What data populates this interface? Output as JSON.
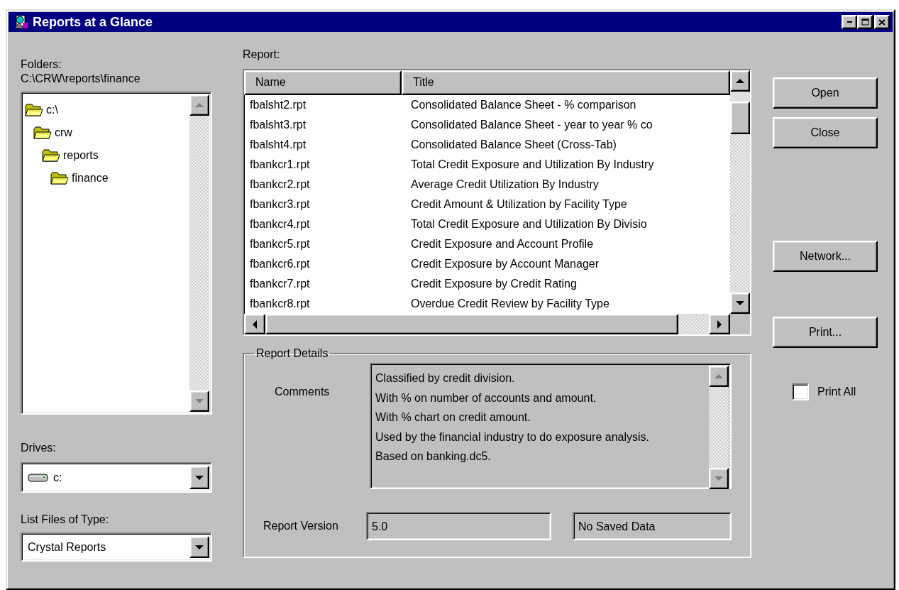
{
  "window": {
    "title": "Reports at a Glance"
  },
  "folders": {
    "label": "Folders:",
    "path": "C:\\CRW\\reports\\finance",
    "tree": [
      {
        "label": "c:\\",
        "children": [
          {
            "label": "crw",
            "children": [
              {
                "label": "reports",
                "children": [
                  {
                    "label": "finance"
                  }
                ]
              }
            ]
          }
        ]
      }
    ]
  },
  "drives": {
    "label": "Drives:",
    "value": "c:"
  },
  "file_type": {
    "label": "List Files of Type:",
    "value": "Crystal Reports"
  },
  "report": {
    "label": "Report:",
    "columns": [
      "Name",
      "Title"
    ],
    "rows": [
      {
        "name": "fbalsht2.rpt",
        "title": "Consolidated Balance Sheet - % comparison"
      },
      {
        "name": "fbalsht3.rpt",
        "title": "Consolidated Balance Sheet - year to year % co"
      },
      {
        "name": "fbalsht4.rpt",
        "title": "Consolidated Balance Sheet (Cross-Tab)"
      },
      {
        "name": "fbankcr1.rpt",
        "title": "Total Credit Exposure and Utilization By Industry"
      },
      {
        "name": "fbankcr2.rpt",
        "title": "Average Credit Utilization By Industry"
      },
      {
        "name": "fbankcr3.rpt",
        "title": "Credit Amount & Utilization by Facility Type"
      },
      {
        "name": "fbankcr4.rpt",
        "title": "Total Credit Exposure and Utilization By Divisio"
      },
      {
        "name": "fbankcr5.rpt",
        "title": "Credit Exposure and Account Profile"
      },
      {
        "name": "fbankcr6.rpt",
        "title": "Credit Exposure by Account Manager"
      },
      {
        "name": "fbankcr7.rpt",
        "title": "Credit Exposure by Credit Rating"
      },
      {
        "name": "fbankcr8.rpt",
        "title": "Overdue Credit Review by Facility Type"
      }
    ]
  },
  "details": {
    "title": "Report Details",
    "comments_label": "Comments",
    "comments": [
      "Classified by credit division.",
      "With % on number of accounts and amount.",
      "With % chart on credit amount.",
      "Used by the financial industry to do exposure analysis.",
      "Based on banking.dc5."
    ],
    "version_label": "Report Version",
    "version": "5.0",
    "saved_data": "No Saved Data"
  },
  "buttons": [
    "Open",
    "Close",
    "Network...",
    "Print..."
  ],
  "print_all": {
    "label": "Print All",
    "checked": false
  }
}
